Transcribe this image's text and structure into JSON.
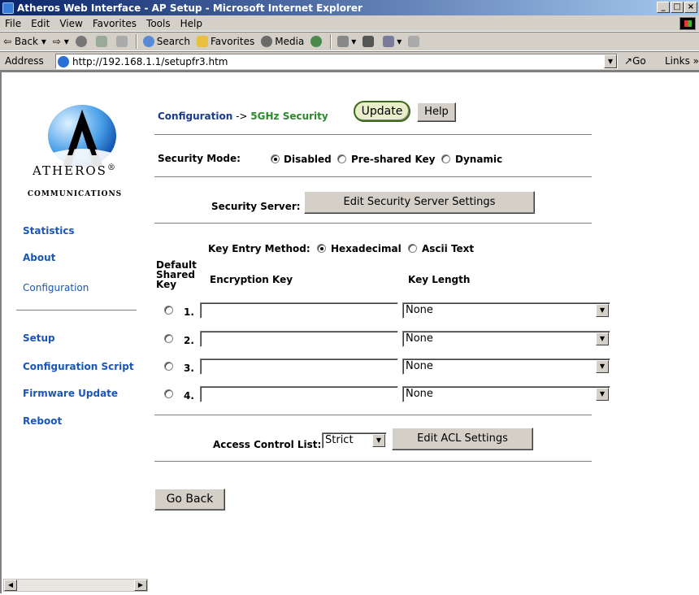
{
  "window": {
    "title": "Atheros Web Interface - AP Setup - Microsoft Internet Explorer"
  },
  "menubar": {
    "items": [
      "File",
      "Edit",
      "View",
      "Favorites",
      "Tools",
      "Help"
    ]
  },
  "toolbar": {
    "back": "Back",
    "search": "Search",
    "favorites": "Favorites",
    "media": "Media"
  },
  "address": {
    "label": "Address",
    "url": "http://192.168.1.1/setupfr3.htm",
    "go": "Go",
    "links": "Links"
  },
  "logo": {
    "brand": "ATHEROS",
    "reg": "®",
    "sub": "COMMUNICATIONS"
  },
  "sidebar": {
    "items": [
      "Statistics",
      "About",
      "Configuration",
      "Setup",
      "Configuration Script",
      "Firmware Update",
      "Reboot"
    ]
  },
  "header": {
    "section": "Configuration",
    "arrow": " -> ",
    "page": "5GHz Security"
  },
  "buttons": {
    "update": "Update",
    "help": "Help",
    "edit_server": "Edit Security Server Settings",
    "edit_acl": "Edit ACL Settings",
    "go_back": "Go Back"
  },
  "security_mode": {
    "label": "Security Mode:",
    "options": [
      "Disabled",
      "Pre-shared Key",
      "Dynamic"
    ],
    "selected": "Disabled"
  },
  "security_server": {
    "label": "Security Server:"
  },
  "key_entry": {
    "label": "Key Entry Method:",
    "options": [
      "Hexadecimal",
      "Ascii Text"
    ],
    "selected": "Hexadecimal"
  },
  "keys_table": {
    "headers": {
      "default": "Default Shared Key",
      "encryption": "Encryption Key",
      "length": "Key Length"
    },
    "rows": [
      {
        "num": "1.",
        "key": "",
        "length": "None"
      },
      {
        "num": "2.",
        "key": "",
        "length": "None"
      },
      {
        "num": "3.",
        "key": "",
        "length": "None"
      },
      {
        "num": "4.",
        "key": "",
        "length": "None"
      }
    ]
  },
  "acl": {
    "label": "Access Control List:",
    "value": "Strict"
  }
}
